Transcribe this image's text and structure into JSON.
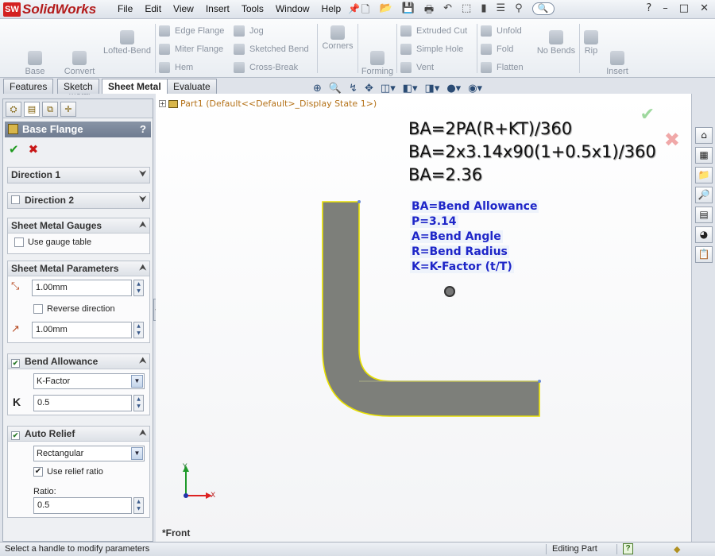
{
  "app": {
    "logo_badge": "SW",
    "logo_text": "SolidWorks"
  },
  "menu": [
    "File",
    "Edit",
    "View",
    "Insert",
    "Tools",
    "Window",
    "Help"
  ],
  "quick_icons": [
    "new-doc-icon",
    "open-icon",
    "save-icon",
    "print-icon",
    "undo-icon",
    "select-icon",
    "rebuild-icon",
    "options-icon"
  ],
  "search_hint": "?",
  "window_buttons": {
    "help": "?",
    "minimize": "–",
    "restore": "□",
    "close": "✕"
  },
  "ribbon": {
    "base_flange": "Base\nFlange/Tab",
    "convert": "Convert\nto Sheet\nMetal",
    "lofted_bend": "Lofted-Bend",
    "edge_flange": "Edge Flange",
    "miter_flange": "Miter Flange",
    "hem": "Hem",
    "jog": "Jog",
    "sketched_bend": "Sketched Bend",
    "cross_break": "Cross-Break",
    "corners": "Corners",
    "forming_tool": "Forming\nTool",
    "extruded_cut": "Extruded Cut",
    "simple_hole": "Simple Hole",
    "vent": "Vent",
    "unfold": "Unfold",
    "fold": "Fold",
    "flatten": "Flatten",
    "no_bends": "No Bends",
    "rip": "Rip",
    "insert_bends": "Insert\nBends"
  },
  "tabs": [
    {
      "label": "Features",
      "active": false
    },
    {
      "label": "Sketch",
      "active": false
    },
    {
      "label": "Sheet Metal",
      "active": true
    },
    {
      "label": "Evaluate",
      "active": false
    }
  ],
  "property_manager": {
    "title": "Base Flange",
    "help": "?",
    "direction1": "Direction 1",
    "direction2": "Direction 2",
    "gauges": {
      "header": "Sheet Metal Gauges",
      "use_gauge_table": "Use gauge table",
      "checked": false
    },
    "parameters": {
      "header": "Sheet Metal Parameters",
      "thickness_value": "1.00mm",
      "reverse_direction": "Reverse direction",
      "radius_value": "1.00mm"
    },
    "bend_allowance": {
      "header": "Bend Allowance",
      "type": "K-Factor",
      "k_label": "K",
      "k_value": "0.5"
    },
    "auto_relief": {
      "header": "Auto Relief",
      "type": "Rectangular",
      "use_relief_ratio": "Use relief ratio",
      "ratio_label": "Ratio:",
      "ratio_value": "0.5"
    }
  },
  "graphics": {
    "tree_label": "Part1  (Default<<Default>_Display State 1>)",
    "formula_lines": [
      "BA=2PA(R+KT)/360",
      "BA=2x3.14x90(1+0.5x1)/360",
      "BA=2.36"
    ],
    "legend_lines": [
      "BA=Bend Allowance",
      "P=3.14",
      "A=Bend Angle",
      "R=Bend Radius",
      "K=K-Factor (t/T)"
    ],
    "view_name": "*Front",
    "axis_y": "Y",
    "axis_x": "X"
  },
  "status": {
    "message": "Select a handle to modify parameters",
    "mode": "Editing Part",
    "help": "?"
  },
  "colors": {
    "part_fill": "#7d7f7a",
    "part_edge": "#e8e000",
    "legend_text": "#1e26c8",
    "accent": "#d32020"
  }
}
